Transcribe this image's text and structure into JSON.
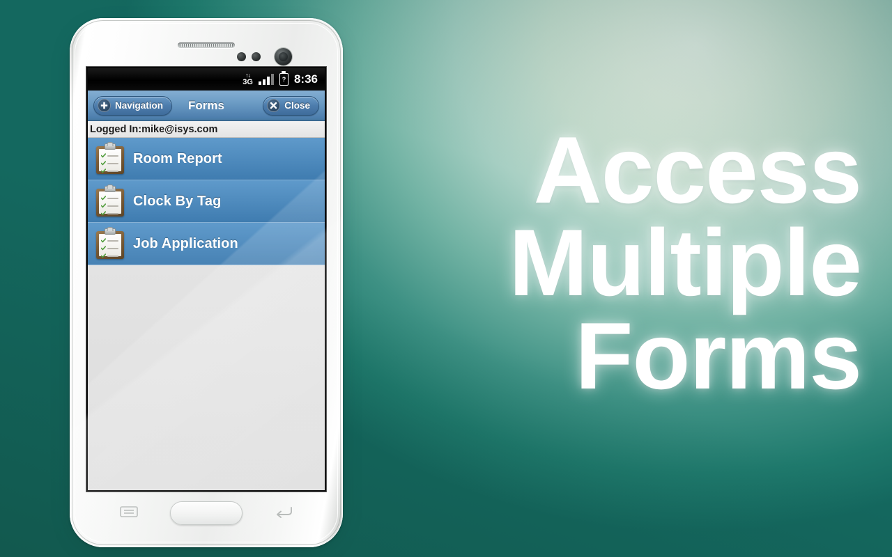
{
  "background": {
    "accent_light": "#eef5ea",
    "accent_dark": "#14685f",
    "mid": "#2b7a6e"
  },
  "headline": {
    "lines": [
      "Access",
      "Multiple",
      "Forms"
    ],
    "color": "#ffffff"
  },
  "phone": {
    "hardware": {
      "earpiece": "earpiece-speaker",
      "sensor_left": "proximity-sensor",
      "sensor_right": "light-sensor",
      "camera": "front-camera",
      "home_button": "home-button",
      "menu_key": "menu-key",
      "back_key": "back-key"
    }
  },
  "screen": {
    "status_bar": {
      "network_arrows": "↑↓",
      "network_type": "3G",
      "signal_icon": "signal-bars-icon",
      "battery_label": "?",
      "time": "8:36"
    },
    "toolbar": {
      "nav_button_label": "Navigation",
      "nav_button_icon": "plus-icon",
      "title": "Forms",
      "close_button_label": "Close",
      "close_button_icon": "x-icon",
      "accent": "#4e7fae"
    },
    "logged_in_bar": {
      "text": "Logged In:mike@isys.com"
    },
    "form_list": {
      "items": [
        {
          "label": "Room Report",
          "icon": "clipboard-checklist-icon"
        },
        {
          "label": "Clock By Tag",
          "icon": "clipboard-checklist-icon"
        },
        {
          "label": "Job Application",
          "icon": "clipboard-checklist-icon"
        }
      ]
    }
  }
}
